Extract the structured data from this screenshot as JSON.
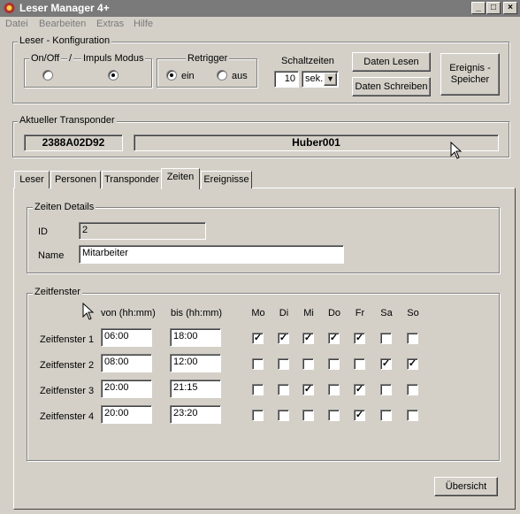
{
  "window": {
    "title": "Leser Manager 4+",
    "btn_min": "_",
    "btn_max": "□",
    "btn_close": "×"
  },
  "menu": [
    "Datei",
    "Bearbeiten",
    "Extras",
    "Hilfe"
  ],
  "config": {
    "group_label": "Leser - Konfiguration",
    "onoff_label": "On/Off",
    "slash": "/",
    "impuls_label": "Impuls Modus",
    "retrigger_label": "Retrigger",
    "ein_label": "ein",
    "aus_label": "aus",
    "schaltzeiten_label": "Schaltzeiten",
    "schaltzeiten_value": "10",
    "schaltzeiten_unit": "sek.",
    "btn_daten_lesen": "Daten Lesen",
    "btn_daten_schreiben": "Daten Schreiben",
    "btn_ereignis_line1": "Ereignis -",
    "btn_ereignis_line2": "Speicher"
  },
  "transponder": {
    "group_label": "Aktueller Transponder",
    "id": "2388A02D92",
    "name": "Huber001"
  },
  "tabs": [
    "Leser",
    "Personen",
    "Transponder",
    "Zeiten",
    "Ereignisse"
  ],
  "zeiten_details": {
    "group_label": "Zeiten Details",
    "id_label": "ID",
    "id_value": "2",
    "name_label": "Name",
    "name_value": "Mitarbeiter"
  },
  "zeitfenster": {
    "group_label": "Zeitfenster",
    "col_von": "von (hh:mm)",
    "col_bis": "bis (hh:mm)",
    "days": [
      "Mo",
      "Di",
      "Mi",
      "Do",
      "Fr",
      "Sa",
      "So"
    ],
    "check_mark": "✓",
    "rows": [
      {
        "label": "Zeitfenster 1",
        "von": "06:00",
        "bis": "18:00",
        "checks": [
          true,
          true,
          true,
          true,
          true,
          false,
          false
        ]
      },
      {
        "label": "Zeitfenster 2",
        "von": "08:00",
        "bis": "12:00",
        "checks": [
          false,
          false,
          false,
          false,
          false,
          true,
          true
        ]
      },
      {
        "label": "Zeitfenster 3",
        "von": "20:00",
        "bis": "21:15",
        "checks": [
          false,
          false,
          true,
          false,
          true,
          false,
          false
        ]
      },
      {
        "label": "Zeitfenster 4",
        "von": "20:00",
        "bis": "23:20",
        "checks": [
          false,
          false,
          false,
          false,
          true,
          false,
          false
        ]
      }
    ]
  },
  "btn_uebersicht": "Übersicht"
}
